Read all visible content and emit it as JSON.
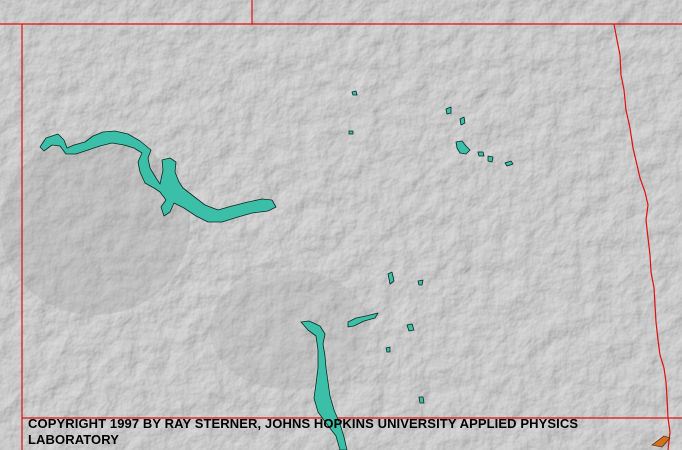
{
  "map": {
    "colors": {
      "terrain": "#b9b9b9",
      "terrain_light": "#d2d2d2",
      "terrain_dark": "#8e8e8e",
      "border": "#e01010",
      "water": "#3cbfa8",
      "water_outline": "#0a2a22"
    }
  },
  "copyright": {
    "text": "COPYRIGHT 1997 BY RAY STERNER, JOHNS HOPKINS UNIVERSITY APPLIED PHYSICS LABORATORY"
  }
}
